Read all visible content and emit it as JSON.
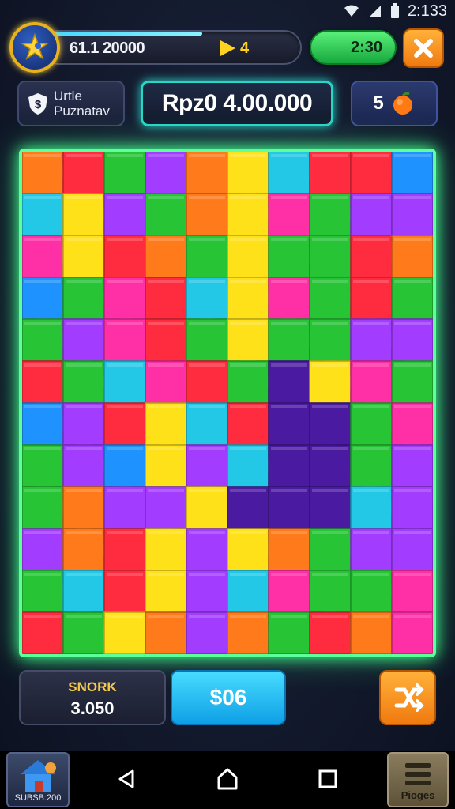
{
  "status_bar": {
    "time": "2:133",
    "icons": [
      "wifi-icon",
      "signal-icon",
      "battery-icon"
    ]
  },
  "hud": {
    "level_badge_icon": "star-bird-icon",
    "progress": {
      "text": "61.1 20000",
      "count": "4",
      "fill": 0.62
    },
    "coins": "2:30",
    "close_icon": "close-icon"
  },
  "title_panel": {
    "badge": "$",
    "line1": "Urtle",
    "line2": "Puznatav"
  },
  "score": "Rpz0 4.00.000",
  "fruit": {
    "count": "5",
    "icon": "orange-fruit-icon"
  },
  "board": {
    "rows": 12,
    "cols": 10,
    "palette": [
      "#27c436",
      "#ff2b3f",
      "#ffe11a",
      "#a23cff",
      "#1e92ff",
      "#ff7a1a",
      "#ff2fa6",
      "#22c8e6",
      "#4a1aa0"
    ],
    "cells": [
      [
        5,
        1,
        0,
        3,
        5,
        2,
        7,
        1,
        1,
        4
      ],
      [
        7,
        2,
        3,
        0,
        5,
        2,
        6,
        0,
        3,
        3
      ],
      [
        6,
        2,
        1,
        5,
        0,
        2,
        0,
        0,
        1,
        5
      ],
      [
        4,
        0,
        6,
        1,
        7,
        2,
        6,
        0,
        1,
        0
      ],
      [
        0,
        3,
        6,
        1,
        0,
        2,
        0,
        0,
        3,
        3
      ],
      [
        1,
        0,
        7,
        6,
        1,
        0,
        8,
        2,
        6,
        0
      ],
      [
        4,
        3,
        1,
        2,
        7,
        1,
        8,
        8,
        0,
        6
      ],
      [
        0,
        3,
        4,
        2,
        3,
        7,
        8,
        8,
        0,
        3
      ],
      [
        0,
        5,
        3,
        3,
        2,
        8,
        8,
        8,
        7,
        3
      ],
      [
        3,
        5,
        1,
        2,
        3,
        2,
        5,
        0,
        3,
        3
      ],
      [
        0,
        7,
        1,
        2,
        3,
        7,
        6,
        0,
        0,
        6
      ],
      [
        1,
        0,
        2,
        5,
        3,
        5,
        0,
        1,
        5,
        6
      ]
    ]
  },
  "stats": {
    "label": "SNORK",
    "value": "3.050"
  },
  "price_button": "$06",
  "shuffle_icon": "shuffle-icon",
  "nav": {
    "home_app_label": "SUBSB:200",
    "pieces_label": "Pioges",
    "buttons": [
      "back-icon",
      "home-icon",
      "recents-icon"
    ]
  },
  "colors": {
    "board_glow": "#5cff9a",
    "score_border": "#28d6c7",
    "coin_green": "#16a83c",
    "accent_orange": "#f07a10",
    "price_blue": "#0ea0e6"
  }
}
